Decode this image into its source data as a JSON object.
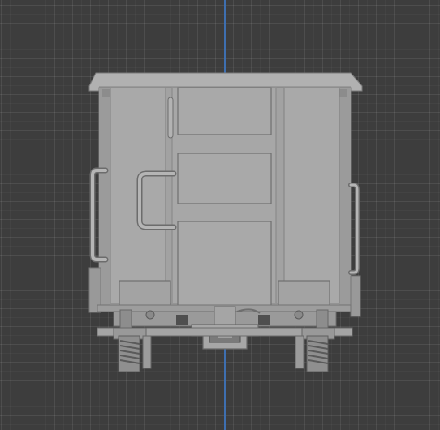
{
  "viewport": {
    "grid_visible": true,
    "background_color": "#3d3d3d",
    "axis_color": "#3e6fb0"
  },
  "model": {
    "subject": "freight-wagon-rear-view",
    "shading": "solid-gray",
    "base_color": "#a7a7a7"
  }
}
